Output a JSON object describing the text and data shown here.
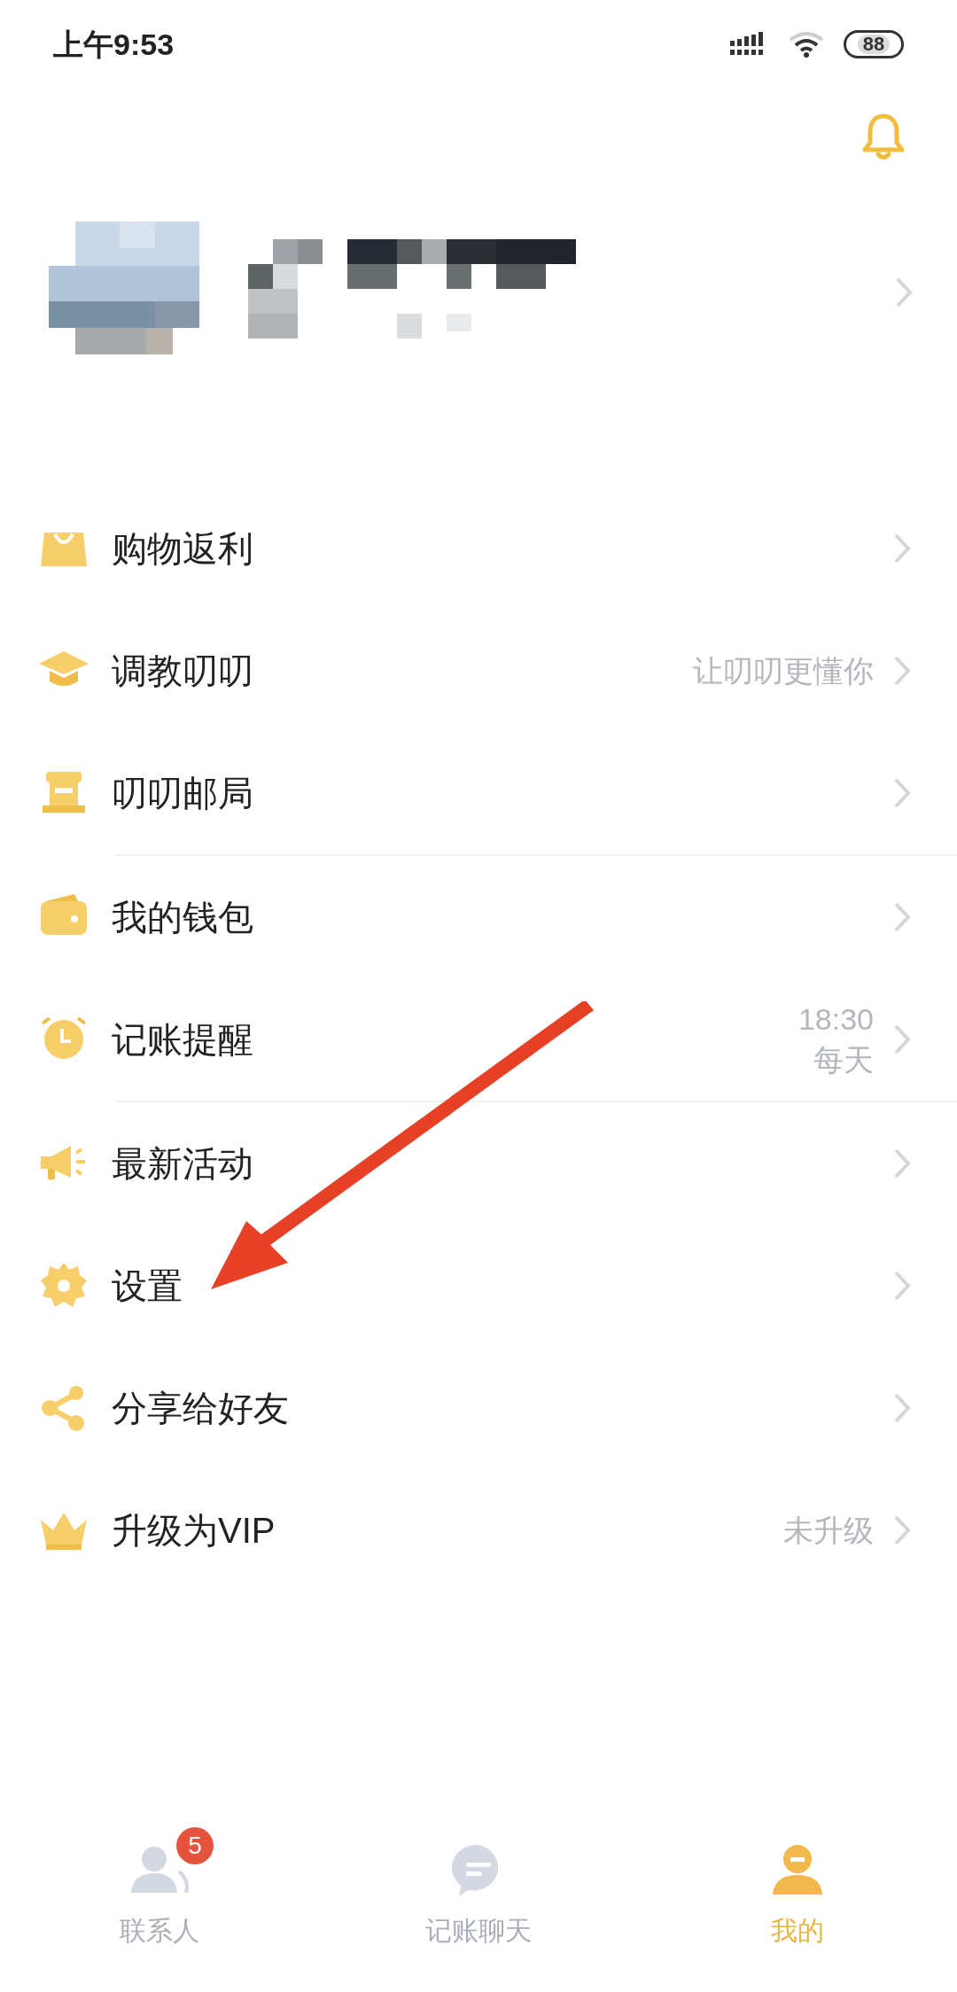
{
  "status_bar": {
    "time": "上午9:53",
    "battery": "88"
  },
  "menu_groups": [
    [
      {
        "label": "购物返利"
      },
      {
        "label": "调教叨叨",
        "detail": [
          "让叨叨更懂你"
        ]
      },
      {
        "label": "叨叨邮局"
      }
    ],
    [
      {
        "label": "我的钱包"
      },
      {
        "label": "记账提醒",
        "detail": [
          "18:30",
          "每天"
        ]
      }
    ],
    [
      {
        "label": "最新活动"
      },
      {
        "label": "设置"
      },
      {
        "label": "分享给好友"
      },
      {
        "label": "升级为VIP",
        "detail": [
          "未升级"
        ]
      }
    ]
  ],
  "bottom_nav": [
    {
      "label": "联系人",
      "selected": false,
      "badge": "5"
    },
    {
      "label": "记账聊天",
      "selected": false
    },
    {
      "label": "我的",
      "selected": true
    }
  ]
}
